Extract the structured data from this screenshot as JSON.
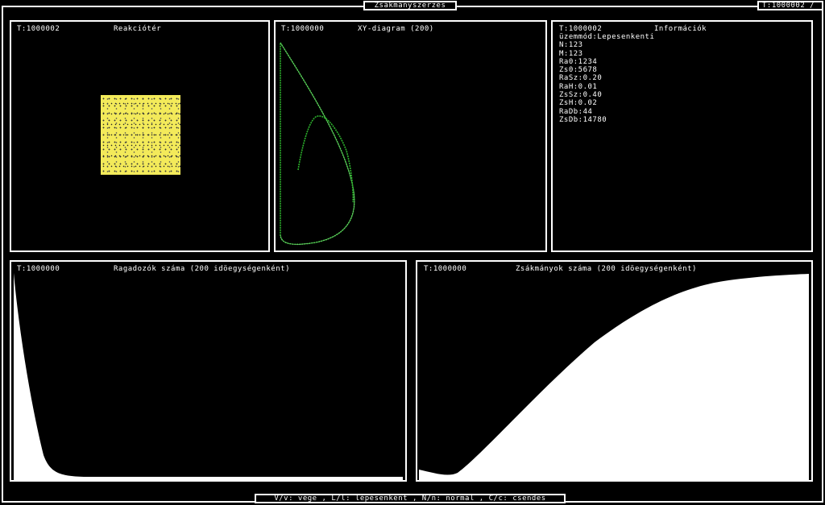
{
  "window": {
    "title": "Zsákmányszerzés",
    "time_tab": "T:1000002 /",
    "status_bar": "V/v: vége , L/l: lépésenként , N/n: normál , C/c: csendes"
  },
  "reaction_space": {
    "time": "T:1000002",
    "title": "Reakciótér",
    "square_color": "#f3ea5a"
  },
  "xy_diagram": {
    "time": "T:1000000",
    "title": "XY-diagram (200)",
    "curve_color": "#2db32d"
  },
  "info": {
    "time": "T:1000002",
    "title": "Információk",
    "lines": [
      "üzemmód:Lepesenkenti",
      "N:123",
      "M:123",
      "Ra0:1234",
      "Zs0:5678",
      "RaSz:0.20",
      "RaH:0.01",
      "ZsSz:0.40",
      "ZsH:0.02",
      "RaDb:44",
      "ZsDb:14780"
    ]
  },
  "predator_chart": {
    "time": "T:1000000",
    "title": "Ragadozók száma (200 idöegységenként)"
  },
  "prey_chart": {
    "time": "T:1000000",
    "title": "Zsákmányok száma (200 idöegységenként)"
  },
  "colors": {
    "background": "#000000",
    "foreground": "#ffffff",
    "fill": "#ffffff"
  }
}
